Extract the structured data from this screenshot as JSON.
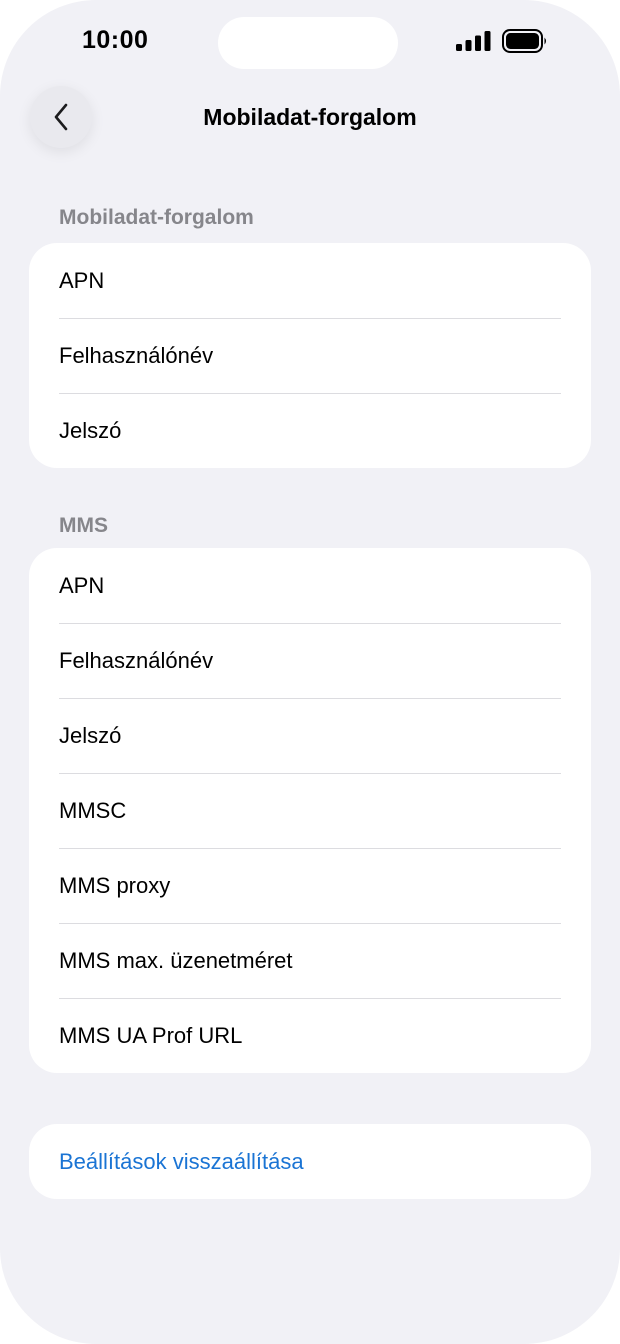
{
  "status_bar": {
    "time": "10:00"
  },
  "nav": {
    "back_icon": "chevron-left-icon",
    "title": "Mobiladat-forgalom"
  },
  "sections": [
    {
      "header": "Mobiladat-forgalom",
      "rows": [
        "APN",
        "Felhasználónév",
        "Jelszó"
      ]
    },
    {
      "header": "MMS",
      "rows": [
        "APN",
        "Felhasználónév",
        "Jelszó",
        "MMSC",
        "MMS proxy",
        "MMS max. üzenetméret",
        "MMS UA Prof URL"
      ]
    }
  ],
  "reset": {
    "label": "Beállítások visszaállítása"
  },
  "colors": {
    "background": "#f1f1f6",
    "card": "#ffffff",
    "header_text": "#86868b",
    "link": "#1a74d4",
    "separator": "#dcdce0"
  }
}
